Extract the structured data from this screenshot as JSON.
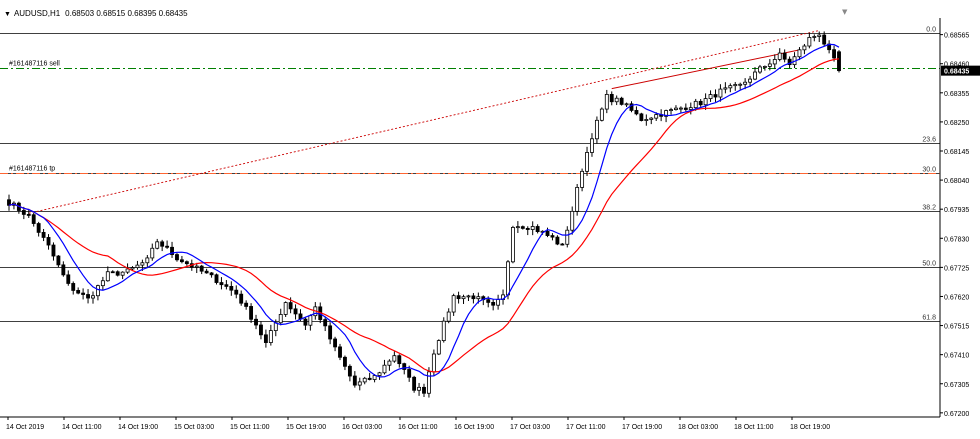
{
  "window": {
    "symbol": "AUDUSD,H1",
    "ohlc": [
      "0.68503",
      "0.68515",
      "0.68395",
      "0.68435"
    ],
    "scroll_marker_icon": "down-triangle-icon"
  },
  "colors": {
    "background": "#ffffff",
    "bull_candle": "#ffffff",
    "bear_candle": "#000000",
    "ma_fast": "#0000ff",
    "ma_slow": "#ff0000",
    "sell_line": "#008000",
    "tp_line": "#ff6633",
    "trend_line": "#cc0000",
    "current_price_bg": "#000000",
    "fib_lines": "#000000"
  },
  "orders": {
    "sell_label": "#161487116 sell",
    "tp_label": "#161487116 tp"
  },
  "current_price": "0.68435",
  "fib_levels": [
    {
      "label": "0.0",
      "price": 0.6857
    },
    {
      "label": "23.6",
      "price": 0.68173
    },
    {
      "label": "38.2",
      "price": 0.67927
    },
    {
      "label": "50.0",
      "price": 0.67728
    },
    {
      "label": "61.8",
      "price": 0.6753
    }
  ],
  "fib_extra": {
    "label": "30.0",
    "price": 0.68064
  },
  "order_prices": {
    "sell": 0.68443,
    "tp": 0.68065
  },
  "y_axis": {
    "min": 0.67185,
    "max": 0.68625,
    "ticks": [
      "0.68565",
      "0.68460",
      "0.68355",
      "0.68250",
      "0.68145",
      "0.68040",
      "0.67935",
      "0.67830",
      "0.67725",
      "0.67620",
      "0.67515",
      "0.67410",
      "0.67305",
      "0.67200"
    ]
  },
  "x_axis": {
    "ticks": [
      "14 Oct 2019",
      "14 Oct 11:00",
      "14 Oct 19:00",
      "15 Oct 03:00",
      "15 Oct 11:00",
      "15 Oct 19:00",
      "16 Oct 03:00",
      "16 Oct 11:00",
      "16 Oct 19:00",
      "17 Oct 03:00",
      "17 Oct 11:00",
      "17 Oct 19:00",
      "18 Oct 03:00",
      "18 Oct 11:00",
      "18 Oct 19:00"
    ]
  },
  "chart_data": {
    "type": "candlestick",
    "title": "AUDUSD,H1",
    "ylim": [
      0.67185,
      0.68625
    ],
    "anchors": [
      [
        0,
        0.6796
      ],
      [
        4,
        0.6791
      ],
      [
        8,
        0.678
      ],
      [
        12,
        0.6766
      ],
      [
        16,
        0.6761
      ],
      [
        20,
        0.677
      ],
      [
        24,
        0.6771
      ],
      [
        28,
        0.6775
      ],
      [
        30,
        0.6782
      ],
      [
        34,
        0.6776
      ],
      [
        38,
        0.6772
      ],
      [
        42,
        0.6768
      ],
      [
        46,
        0.6763
      ],
      [
        50,
        0.6752
      ],
      [
        52,
        0.6745
      ],
      [
        56,
        0.676
      ],
      [
        60,
        0.6752
      ],
      [
        62,
        0.6758
      ],
      [
        66,
        0.6743
      ],
      [
        70,
        0.673
      ],
      [
        74,
        0.6733
      ],
      [
        78,
        0.6741
      ],
      [
        82,
        0.6729
      ],
      [
        84,
        0.6728
      ],
      [
        86,
        0.6742
      ],
      [
        90,
        0.6762
      ],
      [
        94,
        0.6762
      ],
      [
        98,
        0.6758
      ],
      [
        100,
        0.6762
      ],
      [
        102,
        0.6788
      ],
      [
        106,
        0.6787
      ],
      [
        110,
        0.6783
      ],
      [
        112,
        0.678
      ],
      [
        114,
        0.6793
      ],
      [
        116,
        0.6808
      ],
      [
        118,
        0.682
      ],
      [
        121,
        0.6834
      ],
      [
        124,
        0.6832
      ],
      [
        128,
        0.6826
      ],
      [
        132,
        0.6828
      ],
      [
        136,
        0.683
      ],
      [
        140,
        0.6832
      ],
      [
        144,
        0.6836
      ],
      [
        148,
        0.6838
      ],
      [
        152,
        0.6844
      ],
      [
        156,
        0.6849
      ],
      [
        158,
        0.6846
      ],
      [
        162,
        0.6855
      ],
      [
        164,
        0.6857
      ],
      [
        166,
        0.685
      ],
      [
        168,
        0.6844
      ]
    ],
    "overlays": [
      "moving-average-fast (blue)",
      "moving-average-slow (red)",
      "trend-line",
      "fibonacci-retracement"
    ]
  }
}
